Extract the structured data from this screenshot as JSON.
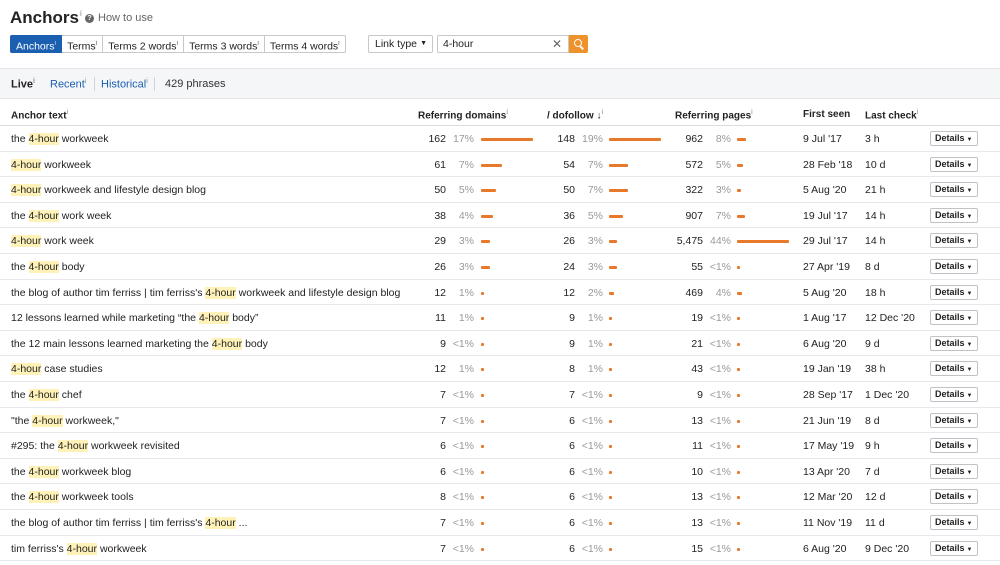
{
  "header": {
    "title": "Anchors",
    "title_sup": "i",
    "how_to_use": "How to use"
  },
  "tabs": [
    {
      "label": "Anchors",
      "sup": "i",
      "active": true
    },
    {
      "label": "Terms",
      "sup": "i",
      "active": false
    },
    {
      "label": "Terms 2 words",
      "sup": "i",
      "active": false
    },
    {
      "label": "Terms 3 words",
      "sup": "i",
      "active": false
    },
    {
      "label": "Terms 4 words",
      "sup": "i",
      "active": false
    }
  ],
  "filters": {
    "link_type_label": "Link type",
    "search_value": "4-hour"
  },
  "subnav": {
    "live": "Live",
    "recent": "Recent",
    "historical": "Historical",
    "sup": "i",
    "phrases": "429 phrases"
  },
  "columns": {
    "anchor_text": "Anchor text",
    "referring_domains": "Referring domains",
    "dofollow": "/ dofollow",
    "referring_pages": "Referring pages",
    "first_seen": "First seen",
    "last_check": "Last check",
    "sup": "i"
  },
  "details_label": "Details",
  "accent_color": "#e8792b",
  "active_tab_color": "#1a5fb0",
  "rows": [
    {
      "pre": "the ",
      "hl": "4-hour",
      "post": " workweek",
      "rd": "162",
      "rd_pct": "17%",
      "rd_v": 17,
      "df": "148",
      "df_pct": "19%",
      "df_v": 19,
      "rp": "962",
      "rp_pct": "8%",
      "rp_v": 8,
      "first": "9 Jul '17",
      "last": "3 h"
    },
    {
      "pre": "",
      "hl": "4-hour",
      "post": " workweek",
      "rd": "61",
      "rd_pct": "7%",
      "rd_v": 7,
      "df": "54",
      "df_pct": "7%",
      "df_v": 7,
      "rp": "572",
      "rp_pct": "5%",
      "rp_v": 5,
      "first": "28 Feb '18",
      "last": "10 d"
    },
    {
      "pre": "",
      "hl": "4-hour",
      "post": " workweek and lifestyle design blog",
      "rd": "50",
      "rd_pct": "5%",
      "rd_v": 5,
      "df": "50",
      "df_pct": "7%",
      "df_v": 7,
      "rp": "322",
      "rp_pct": "3%",
      "rp_v": 3,
      "first": "5 Aug '20",
      "last": "21 h"
    },
    {
      "pre": "the ",
      "hl": "4-hour",
      "post": " work week",
      "rd": "38",
      "rd_pct": "4%",
      "rd_v": 4,
      "df": "36",
      "df_pct": "5%",
      "df_v": 5,
      "rp": "907",
      "rp_pct": "7%",
      "rp_v": 7,
      "first": "19 Jul '17",
      "last": "14 h"
    },
    {
      "pre": "",
      "hl": "4-hour",
      "post": " work week",
      "rd": "29",
      "rd_pct": "3%",
      "rd_v": 3,
      "df": "26",
      "df_pct": "3%",
      "df_v": 3,
      "rp": "5,475",
      "rp_pct": "44%",
      "rp_v": 44,
      "first": "29 Jul '17",
      "last": "14 h"
    },
    {
      "pre": "the ",
      "hl": "4-hour",
      "post": " body",
      "rd": "26",
      "rd_pct": "3%",
      "rd_v": 3,
      "df": "24",
      "df_pct": "3%",
      "df_v": 3,
      "rp": "55",
      "rp_pct": "<1%",
      "rp_v": 0.5,
      "first": "27 Apr '19",
      "last": "8 d"
    },
    {
      "pre": "the blog of author tim ferriss | tim ferriss's ",
      "hl": "4-hour",
      "post": " workweek and lifestyle design blog",
      "rd": "12",
      "rd_pct": "1%",
      "rd_v": 1,
      "df": "12",
      "df_pct": "2%",
      "df_v": 2,
      "rp": "469",
      "rp_pct": "4%",
      "rp_v": 4,
      "first": "5 Aug '20",
      "last": "18 h"
    },
    {
      "pre": "12 lessons learned while marketing “the ",
      "hl": "4-hour",
      "post": " body”",
      "rd": "11",
      "rd_pct": "1%",
      "rd_v": 1,
      "df": "9",
      "df_pct": "1%",
      "df_v": 1,
      "rp": "19",
      "rp_pct": "<1%",
      "rp_v": 0.5,
      "first": "1 Aug '17",
      "last": "12 Dec '20"
    },
    {
      "pre": "the 12 main lessons learned marketing the ",
      "hl": "4-hour",
      "post": " body",
      "rd": "9",
      "rd_pct": "<1%",
      "rd_v": 0.5,
      "df": "9",
      "df_pct": "1%",
      "df_v": 1,
      "rp": "21",
      "rp_pct": "<1%",
      "rp_v": 0.5,
      "first": "6 Aug '20",
      "last": "9 d"
    },
    {
      "pre": "",
      "hl": "4-hour",
      "post": " case studies",
      "rd": "12",
      "rd_pct": "1%",
      "rd_v": 1,
      "df": "8",
      "df_pct": "1%",
      "df_v": 1,
      "rp": "43",
      "rp_pct": "<1%",
      "rp_v": 0.5,
      "first": "19 Jan '19",
      "last": "38 h"
    },
    {
      "pre": "the ",
      "hl": "4-hour",
      "post": " chef",
      "rd": "7",
      "rd_pct": "<1%",
      "rd_v": 0.5,
      "df": "7",
      "df_pct": "<1%",
      "df_v": 0.5,
      "rp": "9",
      "rp_pct": "<1%",
      "rp_v": 0.5,
      "first": "28 Sep '17",
      "last": "1 Dec '20"
    },
    {
      "pre": "\"the ",
      "hl": "4-hour",
      "post": " workweek,\"",
      "rd": "7",
      "rd_pct": "<1%",
      "rd_v": 0.5,
      "df": "6",
      "df_pct": "<1%",
      "df_v": 0.5,
      "rp": "13",
      "rp_pct": "<1%",
      "rp_v": 0.5,
      "first": "21 Jun '19",
      "last": "8 d"
    },
    {
      "pre": "#295: the ",
      "hl": "4-hour",
      "post": " workweek revisited",
      "rd": "6",
      "rd_pct": "<1%",
      "rd_v": 0.5,
      "df": "6",
      "df_pct": "<1%",
      "df_v": 0.5,
      "rp": "11",
      "rp_pct": "<1%",
      "rp_v": 0.5,
      "first": "17 May '19",
      "last": "9 h"
    },
    {
      "pre": "the ",
      "hl": "4-hour",
      "post": " workweek blog",
      "rd": "6",
      "rd_pct": "<1%",
      "rd_v": 0.5,
      "df": "6",
      "df_pct": "<1%",
      "df_v": 0.5,
      "rp": "10",
      "rp_pct": "<1%",
      "rp_v": 0.5,
      "first": "13 Apr '20",
      "last": "7 d"
    },
    {
      "pre": "the ",
      "hl": "4-hour",
      "post": " workweek tools",
      "rd": "8",
      "rd_pct": "<1%",
      "rd_v": 0.5,
      "df": "6",
      "df_pct": "<1%",
      "df_v": 0.5,
      "rp": "13",
      "rp_pct": "<1%",
      "rp_v": 0.5,
      "first": "12 Mar '20",
      "last": "12 d"
    },
    {
      "pre": "the blog of author tim ferriss | tim ferriss's ",
      "hl": "4-hour",
      "post": " ...",
      "rd": "7",
      "rd_pct": "<1%",
      "rd_v": 0.5,
      "df": "6",
      "df_pct": "<1%",
      "df_v": 0.5,
      "rp": "13",
      "rp_pct": "<1%",
      "rp_v": 0.5,
      "first": "11 Nov '19",
      "last": "11 d"
    },
    {
      "pre": "tim ferriss's ",
      "hl": "4-hour",
      "post": " workweek",
      "rd": "7",
      "rd_pct": "<1%",
      "rd_v": 0.5,
      "df": "6",
      "df_pct": "<1%",
      "df_v": 0.5,
      "rp": "15",
      "rp_pct": "<1%",
      "rp_v": 0.5,
      "first": "6 Aug '20",
      "last": "9 Dec '20"
    }
  ]
}
